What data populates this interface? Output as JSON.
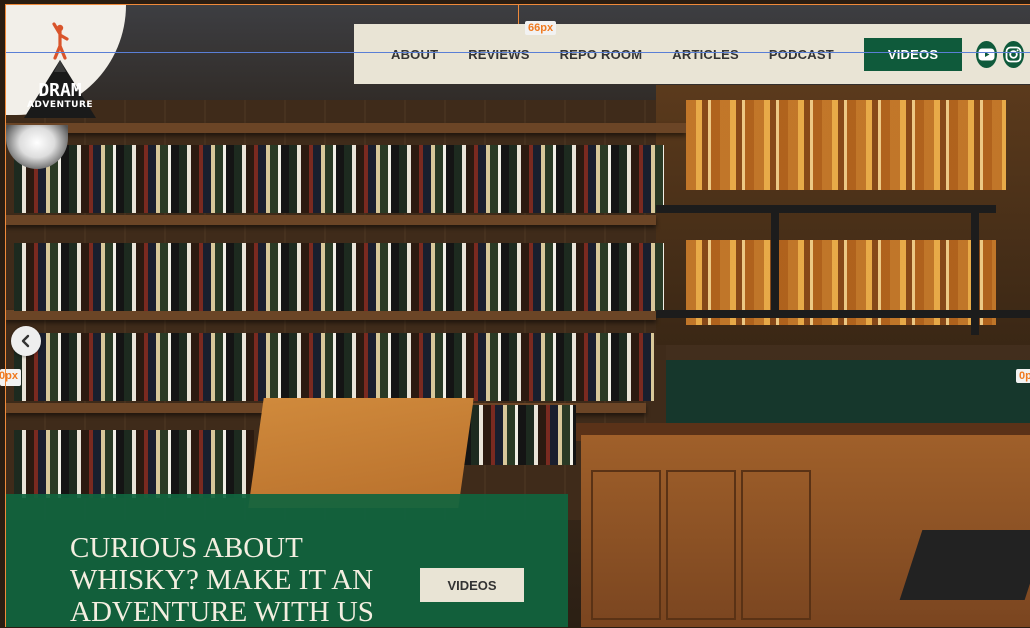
{
  "logo": {
    "line1": "DRAM",
    "line2": "ADVENTURE"
  },
  "nav": {
    "items": [
      {
        "label": "ABOUT"
      },
      {
        "label": "REVIEWS"
      },
      {
        "label": "REPO ROOM"
      },
      {
        "label": "ARTICLES"
      },
      {
        "label": "PODCAST"
      }
    ],
    "videos_button": "VIDEOS",
    "social": [
      "youtube-icon",
      "instagram-icon"
    ]
  },
  "guides": {
    "top_spacing": "66px",
    "left_spacing": "0px",
    "right_spacing": "0p"
  },
  "carousel": {
    "prev_icon": "chevron-left-icon"
  },
  "promo": {
    "heading": "CURIOUS ABOUT WHISKY? MAKE IT AN ADVENTURE WITH US",
    "button": "VIDEOS"
  },
  "colors": {
    "brand_green": "#0f5a3b",
    "nav_bg": "#e9e4d5",
    "guide_orange": "#f08a3a",
    "guide_blue": "#5a7fd6"
  }
}
